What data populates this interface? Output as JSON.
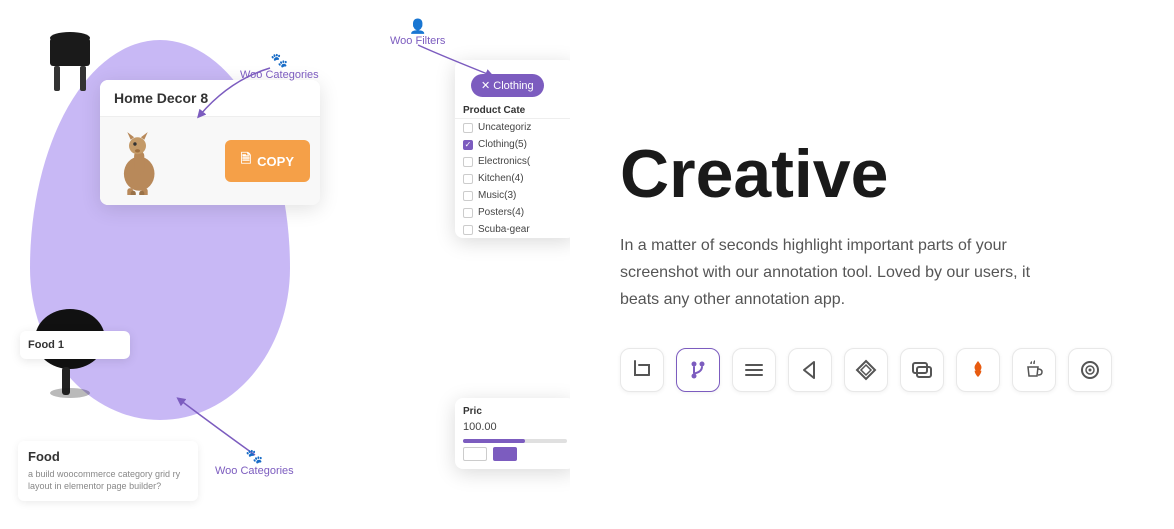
{
  "left": {
    "woo_categories_top": "Woo Categories",
    "woo_categories_bottom": "Woo Categories",
    "woo_filters": "Woo Filters",
    "card_home": {
      "title": "Home Decor",
      "count": "8"
    },
    "copy_button": "COPY",
    "food_label": "Food  1",
    "food_title": "Food",
    "food_desc": "a build woocommerce category grid\nry layout in elementor page builder?",
    "filter": {
      "tag": "✕  Clothing",
      "title": "Product Cate",
      "items": [
        {
          "label": "Uncategoriz",
          "checked": false
        },
        {
          "label": "Clothing(5)",
          "checked": true
        },
        {
          "label": "Electronics(",
          "checked": false
        },
        {
          "label": "Kitchen(4)",
          "checked": false
        },
        {
          "label": "Music(3)",
          "checked": false
        },
        {
          "label": "Posters(4)",
          "checked": false
        },
        {
          "label": "Scuba-gear",
          "checked": false
        }
      ]
    },
    "price": {
      "title": "Pric",
      "value": "100.00"
    }
  },
  "right": {
    "headline": "Creative",
    "description": "In a matter of seconds highlight important parts of your screenshot with our annotation tool. Loved by our users, it beats any other annotation app.",
    "tools": [
      {
        "name": "crop-icon",
        "symbol": "↩",
        "label": "crop"
      },
      {
        "name": "fork-icon",
        "symbol": "⑂",
        "label": "fork",
        "active": true
      },
      {
        "name": "menu-icon",
        "symbol": "≡",
        "label": "menu"
      },
      {
        "name": "back-icon",
        "symbol": "◁",
        "label": "back"
      },
      {
        "name": "layers-icon",
        "symbol": "◈",
        "label": "layers"
      },
      {
        "name": "copy2-icon",
        "symbol": "⧉",
        "label": "copy"
      },
      {
        "name": "fire-icon",
        "symbol": "🔥",
        "label": "fire"
      },
      {
        "name": "coffee-icon",
        "symbol": "☕",
        "label": "coffee"
      },
      {
        "name": "spiral-icon",
        "symbol": "◎",
        "label": "spiral"
      }
    ]
  }
}
